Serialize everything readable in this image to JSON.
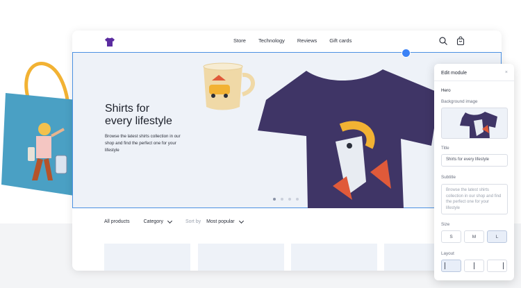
{
  "header": {
    "nav": [
      "Store",
      "Technology",
      "Reviews",
      "Gift cards"
    ]
  },
  "hero": {
    "title": "Shirts for\nevery lifestyle",
    "subtitle": "Browse the latest shirts collection in our shop and find the perfect one for your lifestyle"
  },
  "filters": {
    "all": "All products",
    "category": "Category",
    "sort_label": "Sort by",
    "sort_value": "Most popular"
  },
  "panel": {
    "title": "Edit module",
    "close": "×",
    "section": "Hero",
    "bg_label": "Background image",
    "title_label": "Title",
    "title_value": "Shirts for every lifestyle",
    "subtitle_label": "Subtitle",
    "subtitle_value": "Browse the latest shirts collection in our shop and find the perfect one for your lifestyle",
    "size_label": "Size",
    "sizes": [
      "S",
      "M",
      "L"
    ],
    "layout_label": "Layout"
  },
  "colors": {
    "accent": "#3b82f6",
    "shirt": "#3f3566",
    "bag": "#4aa0c4",
    "bag_strap": "#f2b233"
  }
}
